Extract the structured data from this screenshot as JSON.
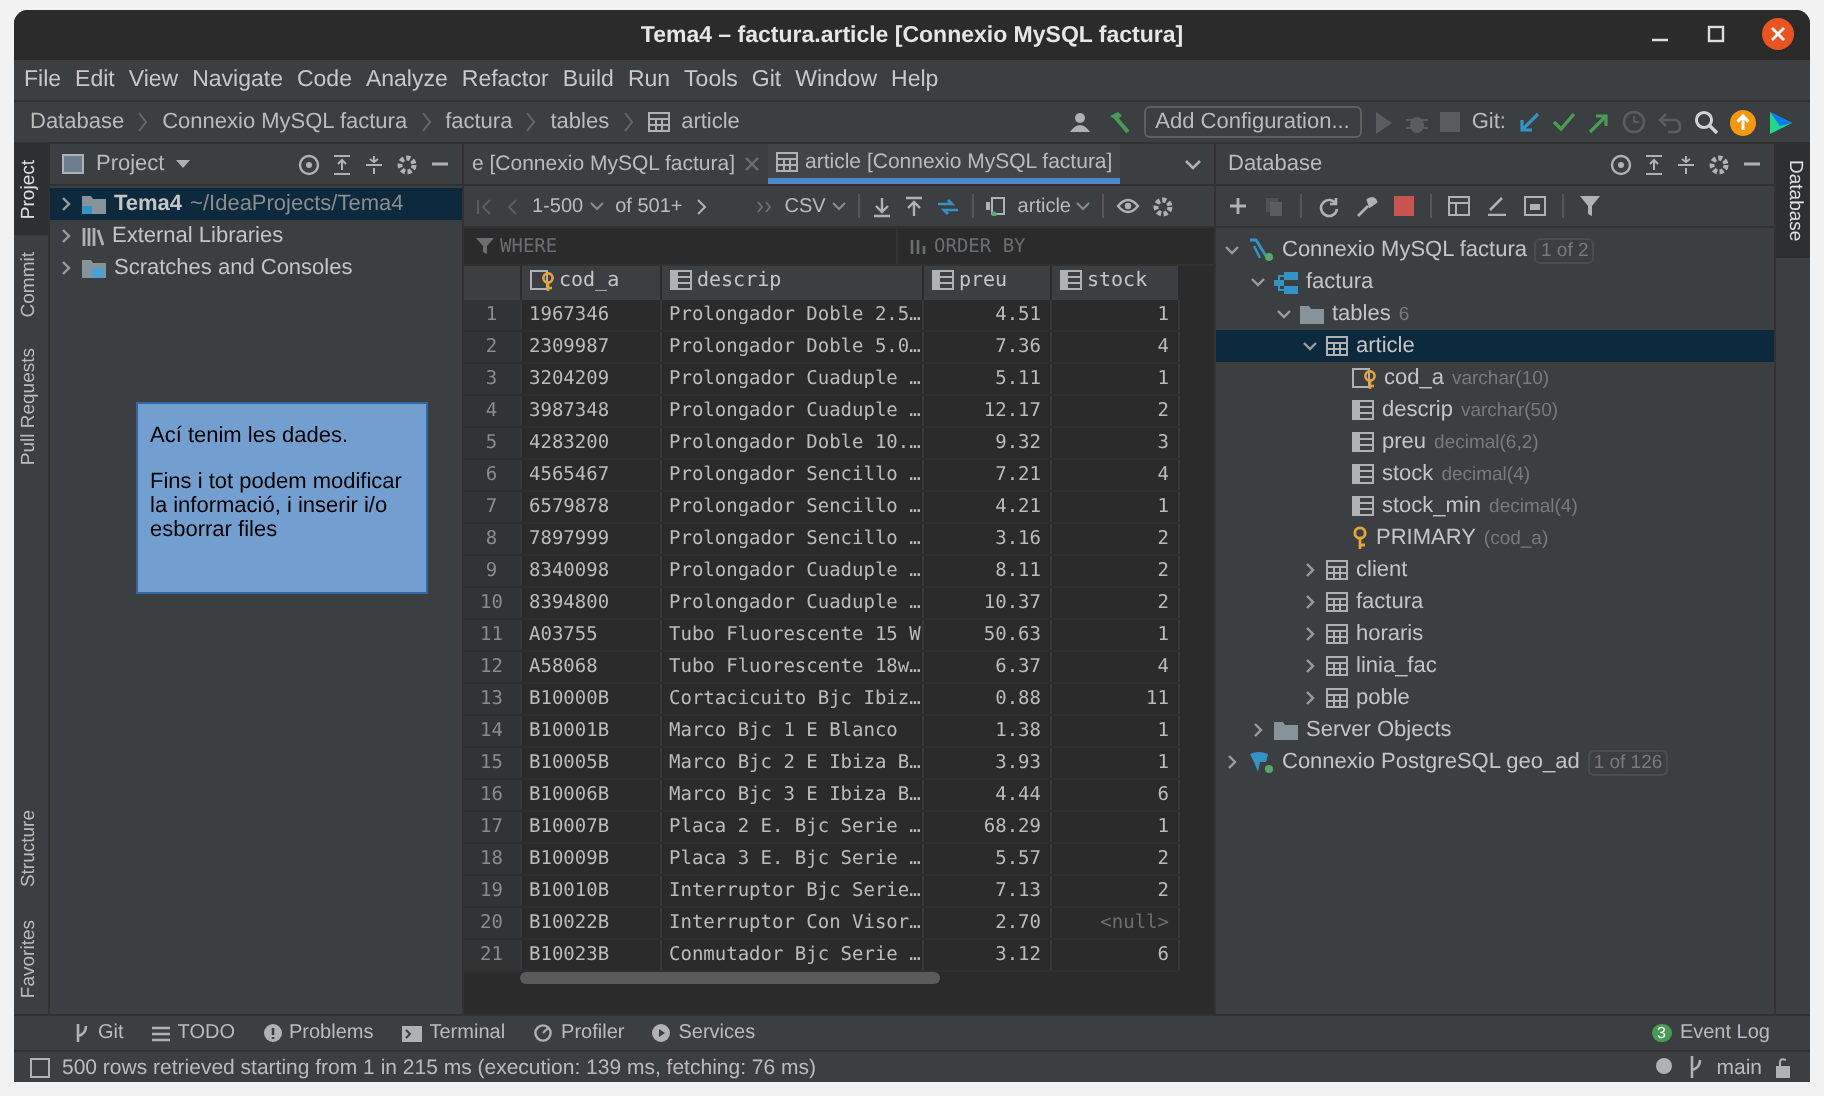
{
  "window": {
    "title": "Tema4 – factura.article [Connexio MySQL factura]"
  },
  "menu": [
    "File",
    "Edit",
    "View",
    "Navigate",
    "Code",
    "Analyze",
    "Refactor",
    "Build",
    "Run",
    "Tools",
    "Git",
    "Window",
    "Help"
  ],
  "breadcrumbs": [
    {
      "label": "Database",
      "kind": "text"
    },
    {
      "label": "Connexio MySQL factura",
      "kind": "text"
    },
    {
      "label": "factura",
      "kind": "text"
    },
    {
      "label": "tables",
      "kind": "text"
    },
    {
      "label": "article",
      "kind": "table"
    }
  ],
  "toolbar": {
    "configuration": "Add Configuration...",
    "git_label": "Git:"
  },
  "left_tabs": [
    {
      "label": "Project",
      "selected": true
    },
    {
      "label": "Commit",
      "selected": false
    },
    {
      "label": "Pull Requests",
      "selected": false
    }
  ],
  "left_tabs_bottom": [
    {
      "label": "Structure",
      "selected": false
    },
    {
      "label": "Favorites",
      "selected": false
    }
  ],
  "right_tabs": [
    {
      "label": "Database",
      "selected": true
    }
  ],
  "project": {
    "title": "Project",
    "items": [
      {
        "name": "Tema4",
        "path": "~/IdeaProjects/Tema4",
        "kind": "module",
        "selected": true
      },
      {
        "name": "External Libraries",
        "kind": "library",
        "selected": false
      },
      {
        "name": "Scratches and Consoles",
        "kind": "scratch",
        "selected": false
      }
    ]
  },
  "note": {
    "paragraphs": [
      "Ací tenim les dades.",
      "Fins i tot podem modificar la informació, i inserir i/o esborrar files"
    ]
  },
  "editor": {
    "tabs": [
      {
        "label": "e [Connexio MySQL factura]",
        "selected": false
      },
      {
        "label": "article [Connexio MySQL factura]",
        "selected": true
      }
    ],
    "pager": {
      "range": "1-500",
      "total": "of 501+",
      "format": "CSV",
      "table": "article"
    },
    "filter": {
      "where": {
        "placeholder": "WHERE"
      },
      "order_by": {
        "placeholder": "ORDER BY"
      }
    },
    "table": {
      "columns": [
        {
          "name": "cod_a",
          "kind": "key"
        },
        {
          "name": "descrip",
          "kind": "column"
        },
        {
          "name": "preu",
          "kind": "column"
        },
        {
          "name": "stock",
          "kind": "column"
        }
      ],
      "rows": [
        {
          "n": "1",
          "cod_a": "1967346",
          "descrip": "Prolongador Doble 2.5…",
          "preu": "4.51",
          "stock": "1",
          "null_stock": false
        },
        {
          "n": "2",
          "cod_a": "2309987",
          "descrip": "Prolongador Doble 5.0…",
          "preu": "7.36",
          "stock": "4",
          "null_stock": false
        },
        {
          "n": "3",
          "cod_a": "3204209",
          "descrip": "Prolongador Cuaduple …",
          "preu": "5.11",
          "stock": "1",
          "null_stock": false
        },
        {
          "n": "4",
          "cod_a": "3987348",
          "descrip": "Prolongador Cuaduple …",
          "preu": "12.17",
          "stock": "2",
          "null_stock": false
        },
        {
          "n": "5",
          "cod_a": "4283200",
          "descrip": "Prolongador Doble 10.…",
          "preu": "9.32",
          "stock": "3",
          "null_stock": false
        },
        {
          "n": "6",
          "cod_a": "4565467",
          "descrip": "Prolongador Sencillo …",
          "preu": "7.21",
          "stock": "4",
          "null_stock": false
        },
        {
          "n": "7",
          "cod_a": "6579878",
          "descrip": "Prolongador Sencillo …",
          "preu": "4.21",
          "stock": "1",
          "null_stock": false
        },
        {
          "n": "8",
          "cod_a": "7897999",
          "descrip": "Prolongador Sencillo …",
          "preu": "3.16",
          "stock": "2",
          "null_stock": false
        },
        {
          "n": "9",
          "cod_a": "8340098",
          "descrip": "Prolongador Cuaduple …",
          "preu": "8.11",
          "stock": "2",
          "null_stock": false
        },
        {
          "n": "10",
          "cod_a": "8394800",
          "descrip": "Prolongador Cuaduple …",
          "preu": "10.37",
          "stock": "2",
          "null_stock": false
        },
        {
          "n": "11",
          "cod_a": "A03755",
          "descrip": "Tubo Fluorescente 15 W",
          "preu": "50.63",
          "stock": "1",
          "null_stock": false
        },
        {
          "n": "12",
          "cod_a": "A58068",
          "descrip": "Tubo Fluorescente 18w…",
          "preu": "6.37",
          "stock": "4",
          "null_stock": false
        },
        {
          "n": "13",
          "cod_a": "B10000B",
          "descrip": "Cortacicuito Bjc Ibiz…",
          "preu": "0.88",
          "stock": "11",
          "null_stock": false
        },
        {
          "n": "14",
          "cod_a": "B10001B",
          "descrip": "Marco Bjc 1 E Blanco",
          "preu": "1.38",
          "stock": "1",
          "null_stock": false
        },
        {
          "n": "15",
          "cod_a": "B10005B",
          "descrip": "Marco Bjc 2 E Ibiza B…",
          "preu": "3.93",
          "stock": "1",
          "null_stock": false
        },
        {
          "n": "16",
          "cod_a": "B10006B",
          "descrip": "Marco Bjc 3 E Ibiza B…",
          "preu": "4.44",
          "stock": "6",
          "null_stock": false
        },
        {
          "n": "17",
          "cod_a": "B10007B",
          "descrip": "Placa 2 E. Bjc Serie …",
          "preu": "68.29",
          "stock": "1",
          "null_stock": false
        },
        {
          "n": "18",
          "cod_a": "B10009B",
          "descrip": "Placa 3 E. Bjc Serie …",
          "preu": "5.57",
          "stock": "2",
          "null_stock": false
        },
        {
          "n": "19",
          "cod_a": "B10010B",
          "descrip": "Interruptor Bjc Serie…",
          "preu": "7.13",
          "stock": "2",
          "null_stock": false
        },
        {
          "n": "20",
          "cod_a": "B10022B",
          "descrip": "Interruptor Con Visor…",
          "preu": "2.70",
          "stock": "<null>",
          "null_stock": true
        },
        {
          "n": "21",
          "cod_a": "B10023B",
          "descrip": "Conmutador Bjc Serie …",
          "preu": "3.12",
          "stock": "6",
          "null_stock": false
        }
      ]
    }
  },
  "database": {
    "title": "Database",
    "tree": [
      {
        "name": "Connexio MySQL factura",
        "kind": "connection",
        "badge": "1 of 2",
        "expanded": true,
        "selected": false,
        "children": [
          {
            "name": "factura",
            "kind": "schema",
            "expanded": true,
            "selected": false,
            "children": [
              {
                "name": "tables",
                "kind": "folder",
                "count": "6",
                "expanded": true,
                "selected": false,
                "children": [
                  {
                    "name": "article",
                    "kind": "table",
                    "expanded": true,
                    "selected": true,
                    "children": [
                      {
                        "name": "cod_a",
                        "kind": "key-column",
                        "detail": "varchar(10)",
                        "selected": false
                      },
                      {
                        "name": "descrip",
                        "kind": "column",
                        "detail": "varchar(50)",
                        "selected": false
                      },
                      {
                        "name": "preu",
                        "kind": "column",
                        "detail": "decimal(6,2)",
                        "selected": false
                      },
                      {
                        "name": "stock",
                        "kind": "column",
                        "detail": "decimal(4)",
                        "selected": false
                      },
                      {
                        "name": "stock_min",
                        "kind": "column",
                        "detail": "decimal(4)",
                        "selected": false
                      },
                      {
                        "name": "PRIMARY",
                        "kind": "index",
                        "detail": "(cod_a)",
                        "selected": false
                      }
                    ]
                  },
                  {
                    "name": "client",
                    "kind": "table",
                    "expanded": false,
                    "selected": false
                  },
                  {
                    "name": "factura",
                    "kind": "table",
                    "expanded": false,
                    "selected": false
                  },
                  {
                    "name": "horaris",
                    "kind": "table",
                    "expanded": false,
                    "selected": false
                  },
                  {
                    "name": "linia_fac",
                    "kind": "table",
                    "expanded": false,
                    "selected": false
                  },
                  {
                    "name": "poble",
                    "kind": "table",
                    "expanded": false,
                    "selected": false
                  }
                ]
              }
            ]
          },
          {
            "name": "Server Objects",
            "kind": "folder",
            "expanded": false,
            "selected": false
          }
        ]
      },
      {
        "name": "Connexio PostgreSQL geo_ad",
        "kind": "connection-pg",
        "badge": "1 of 126",
        "expanded": false,
        "selected": false
      }
    ]
  },
  "tool_tabs": [
    {
      "label": "Git",
      "kind": "git"
    },
    {
      "label": "TODO",
      "kind": "todo"
    },
    {
      "label": "Problems",
      "kind": "problems"
    },
    {
      "label": "Terminal",
      "kind": "terminal"
    },
    {
      "label": "Profiler",
      "kind": "profiler"
    },
    {
      "label": "Services",
      "kind": "services"
    }
  ],
  "event_log": {
    "label": "Event Log",
    "badge": "3"
  },
  "status_bar": {
    "message": "500 rows retrieved starting from 1 in 215 ms (execution: 139 ms, fetching: 76 ms)",
    "branch": "main"
  }
}
